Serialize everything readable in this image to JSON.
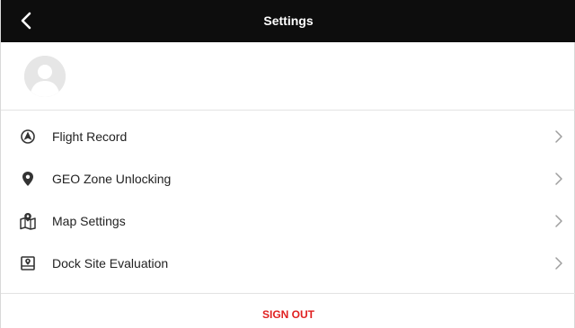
{
  "header": {
    "title": "Settings",
    "back_icon": "chevron-left-icon"
  },
  "profile": {
    "avatar_icon": "default-avatar-icon"
  },
  "menu": {
    "items": [
      {
        "label": "Flight Record",
        "icon": "flight-record-icon"
      },
      {
        "label": "GEO Zone Unlocking",
        "icon": "location-pin-icon"
      },
      {
        "label": "Map Settings",
        "icon": "map-icon"
      },
      {
        "label": "Dock Site Evaluation",
        "icon": "dock-site-icon"
      }
    ],
    "chevron_icon": "chevron-right-icon"
  },
  "footer": {
    "signout_label": "SIGN OUT"
  },
  "colors": {
    "topbar_bg": "#0d0d0d",
    "signout": "#e02020",
    "chevron": "#9e9e9e",
    "divider": "#e3e3e3"
  }
}
